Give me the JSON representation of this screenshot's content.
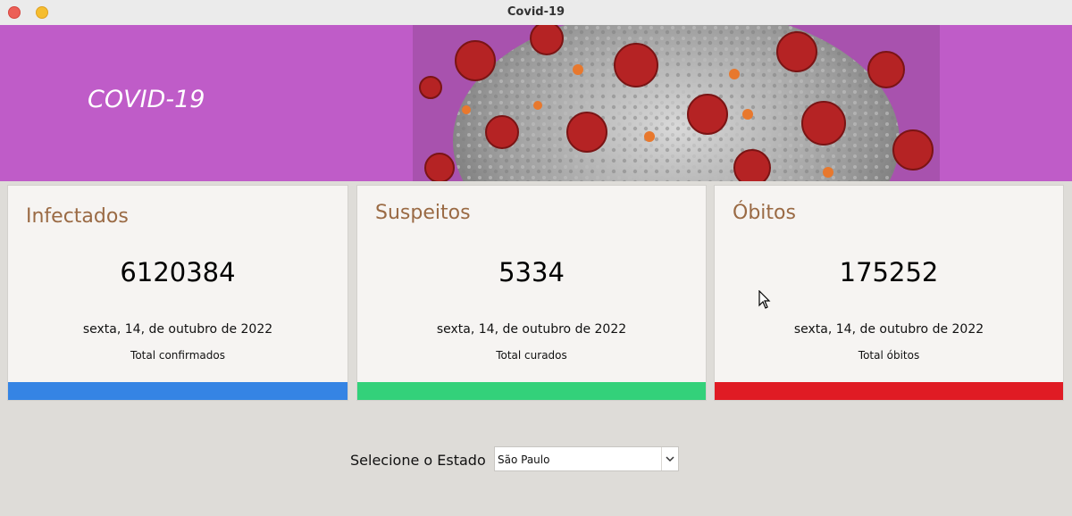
{
  "window": {
    "title": "Covid-19"
  },
  "banner": {
    "title": "COVID-19"
  },
  "cards": [
    {
      "title": "Infectados",
      "value": "6120384",
      "date": "sexta, 14, de outubro de 2022",
      "total_label": "Total confirmados",
      "color": "#3584e4"
    },
    {
      "title": "Suspeitos",
      "value": "5334",
      "date": "sexta, 14, de outubro de 2022",
      "total_label": "Total curados",
      "color": "#33d17a"
    },
    {
      "title": "Óbitos",
      "value": "175252",
      "date": "sexta, 14, de outubro de 2022",
      "total_label": "Total óbitos",
      "color": "#e01b24"
    }
  ],
  "state_selector": {
    "label": "Selecione o Estado",
    "selected": "São Paulo"
  },
  "colors": {
    "banner": "#bf5cc8",
    "background": "#dedcd8",
    "card_title": "#9a6a44"
  },
  "icons": {
    "close": "close-icon",
    "minimize": "minimize-icon",
    "dropdown": "chevron-down-icon"
  }
}
